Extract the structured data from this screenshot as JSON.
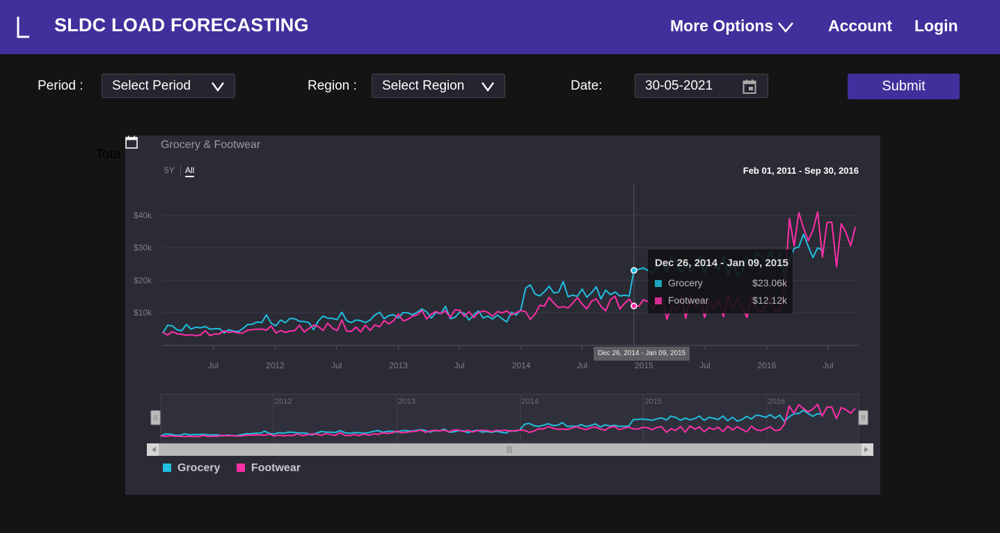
{
  "app": {
    "brand_title": "SLDC LOAD FORECASTING",
    "logo_icon": "letter-l-logo-icon",
    "nav": {
      "more_options": "More Options",
      "account": "Account",
      "login": "Login"
    },
    "colors": {
      "topbar": "#40309b",
      "page_bg": "#141414",
      "accent": "#40309b"
    }
  },
  "filters": {
    "period_label": "Period :",
    "period_value": "Select Period",
    "region_label": "Region :",
    "region_value": "Select Region",
    "date_label": "Date:",
    "date_value": "30-05-2021",
    "submit_label": "Submit"
  },
  "background_text": "Tota",
  "chart_data": {
    "type": "line",
    "title": "Grocery & Footwear",
    "range_buttons": [
      "5Y",
      "All"
    ],
    "selected_range": "All",
    "date_range": "Feb 01, 2011 - Sep 30, 2016",
    "x_start": "2011-02-01",
    "x_end": "2016-09-30",
    "x_step_weeks": 2,
    "x_tick_labels": [
      "Jul",
      "2012",
      "Jul",
      "2013",
      "Jul",
      "2014",
      "Jul",
      "2015",
      "Jul",
      "2016",
      "Jul"
    ],
    "navigator_tick_labels": [
      "2012",
      "2013",
      "2014",
      "2015",
      "2016"
    ],
    "y_tick_labels": [
      "$10k",
      "$20k",
      "$30k",
      "$40k"
    ],
    "ylim": [
      0,
      50000
    ],
    "series": [
      {
        "name": "Grocery",
        "color": "#1fc0e0",
        "values": [
          3800,
          6200,
          6000,
          4800,
          4500,
          6400,
          5000,
          5600,
          5400,
          5800,
          5000,
          5100,
          5200,
          3800,
          4800,
          4400,
          4200,
          5200,
          6400,
          6500,
          7200,
          7000,
          9400,
          6800,
          6000,
          7800,
          7000,
          8300,
          8200,
          7400,
          7300,
          7000,
          4800,
          7500,
          9000,
          8400,
          8300,
          7900,
          10200,
          7600,
          7000,
          7800,
          7600,
          7000,
          7800,
          9300,
          10200,
          8200,
          9200,
          9400,
          8400,
          10100,
          10000,
          9400,
          10200,
          11200,
          10300,
          8400,
          10200,
          9700,
          12000,
          8200,
          8600,
          10200,
          9800,
          7800,
          9400,
          10600,
          8400,
          9000,
          8100,
          9300,
          8200,
          7200,
          10200,
          9300,
          11000,
          17600,
          18600,
          15800,
          15200,
          16500,
          18200,
          16100,
          16400,
          19600,
          15000,
          15400,
          15100,
          17300,
          14800,
          16200,
          18000,
          14300,
          17000,
          15600,
          16400,
          15200,
          15400,
          15200,
          23060,
          23400,
          23800,
          23000,
          22300,
          24000,
          25200,
          22600,
          27200,
          25600,
          22400,
          24800,
          22800,
          24300,
          27400,
          22100,
          25800,
          24700,
          23300,
          27300,
          21700,
          25800,
          21300,
          23000,
          27000,
          23800,
          28500,
          27500,
          25700,
          28900,
          24800,
          28400,
          21000,
          26400,
          29800,
          30300,
          34200,
          30400,
          27000,
          30000,
          29200
        ]
      },
      {
        "name": "Footwear",
        "color": "#ff2fa6",
        "values": [
          4000,
          3200,
          4200,
          3600,
          3400,
          3100,
          3300,
          3000,
          3200,
          4500,
          3000,
          3500,
          3500,
          4500,
          4000,
          4200,
          3800,
          3800,
          4700,
          4800,
          5000,
          5000,
          4700,
          6000,
          3800,
          4600,
          4000,
          4400,
          4500,
          6200,
          4100,
          5200,
          6200,
          5800,
          4600,
          6800,
          5300,
          4500,
          7800,
          4400,
          4300,
          5600,
          4100,
          6200,
          4600,
          6300,
          5700,
          7600,
          6600,
          7600,
          9600,
          7500,
          8000,
          9000,
          9400,
          10800,
          8100,
          9600,
          10400,
          9800,
          10600,
          8600,
          10900,
          10800,
          8900,
          10400,
          8500,
          10100,
          10600,
          10200,
          8900,
          10400,
          10000,
          10600,
          9400,
          10000,
          10700,
          10400,
          8000,
          9600,
          12300,
          12100,
          14800,
          13000,
          11600,
          11900,
          11500,
          13000,
          14700,
          12700,
          11200,
          13600,
          14300,
          12000,
          10600,
          14000,
          15100,
          11200,
          12900,
          14200,
          12120,
          12000,
          14000,
          13500,
          11200,
          13900,
          14700,
          8000,
          12300,
          10300,
          15100,
          8300,
          15600,
          11800,
          14600,
          8600,
          13500,
          11400,
          14200,
          8800,
          15400,
          10900,
          14700,
          11600,
          8600,
          15400,
          11100,
          10100,
          12200,
          14700,
          10200,
          10900,
          17600,
          39000,
          30600,
          40800,
          36100,
          32200,
          35400,
          41100,
          27100,
          37800,
          37900,
          24200,
          37400,
          34700,
          30600,
          36500
        ]
      }
    ],
    "tooltip": {
      "title": "Dec 26, 2014 - Jan 09, 2015",
      "rows": [
        {
          "name": "Grocery",
          "value": "$23.06k"
        },
        {
          "name": "Footwear",
          "value": "$12.12k"
        }
      ],
      "crosshair_label": "Dec 26, 2014 - Jan 09, 2015",
      "index": 100
    },
    "legend": [
      "Grocery",
      "Footwear"
    ],
    "grid": true,
    "navigator": true,
    "scrollbar": true,
    "colors": {
      "panel_bg": "#2b2b36"
    }
  }
}
